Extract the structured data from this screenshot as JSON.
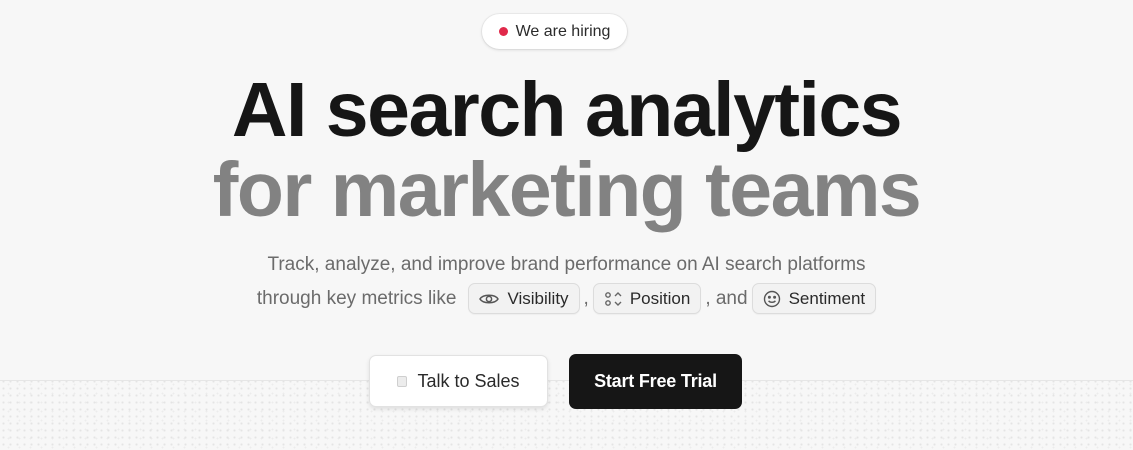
{
  "hiring_badge": {
    "label": "We are hiring",
    "dot_color": "#e0294a"
  },
  "hero": {
    "title_line1": "AI search analytics",
    "title_line2": "for marketing teams",
    "subtitle_line1": "Track, analyze, and improve brand performance on AI search platforms",
    "subtitle_lead": "through key metrics like",
    "metrics": [
      {
        "label": "Visibility",
        "icon": "eye-icon"
      },
      {
        "label": "Position",
        "icon": "position-icon"
      },
      {
        "label": "Sentiment",
        "icon": "smiley-icon"
      }
    ],
    "sep_comma": ",",
    "sep_and": ", and"
  },
  "cta": {
    "sales_label": "Talk to Sales",
    "trial_label": "Start Free Trial"
  },
  "colors": {
    "background": "#f7f7f7",
    "title_primary": "#161616",
    "title_secondary": "#828282",
    "trial_button": "#161616"
  }
}
